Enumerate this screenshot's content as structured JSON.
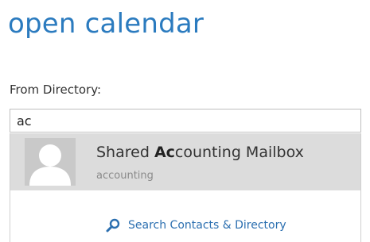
{
  "header": {
    "title": "open calendar"
  },
  "form": {
    "from_label": "From Directory:",
    "search_value": "ac"
  },
  "suggestions": [
    {
      "name_prefix": "Shared ",
      "name_match": "Ac",
      "name_suffix": "counting Mailbox",
      "alias": "accounting"
    }
  ],
  "search_link": {
    "label": "Search Contacts & Directory",
    "icon": "search-icon"
  },
  "colors": {
    "accent": "#2b7bbf",
    "highlight_row": "#dcdcdc"
  }
}
